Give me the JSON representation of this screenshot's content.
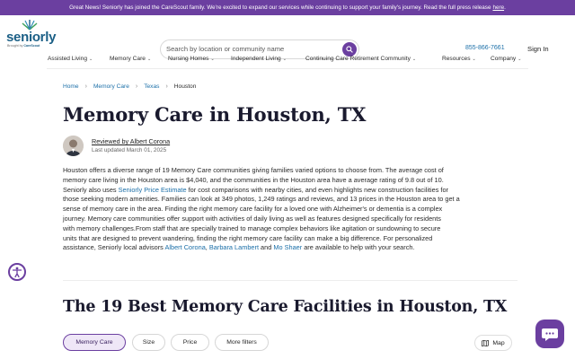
{
  "banner": {
    "text": "Great News! Seniorly has joined the CareScout family. We're excited to expand our services while continuing to support your family's journey. Read the full press release",
    "link": "here",
    "end": "."
  },
  "brand": {
    "name": "seniorly",
    "sub_prefix": "Brought by",
    "sub_brand": "CareScout",
    "color": "#1b5f86",
    "accent": "#6b3fa0"
  },
  "search": {
    "placeholder": "Search by location or community name",
    "icon": "search-icon"
  },
  "header": {
    "phone": "855-866-7661",
    "signin": "Sign In"
  },
  "nav": {
    "items": [
      "Assisted Living",
      "Memory Care",
      "Nursing Homes",
      "Independent Living",
      "Continuing Care Retirement Community",
      "Resources",
      "Company"
    ]
  },
  "breadcrumb": {
    "items": [
      "Home",
      "Memory Care",
      "Texas"
    ],
    "current": "Houston"
  },
  "page": {
    "title": "Memory Care in Houston, TX",
    "reviewed_by": "Reviewed by Albert Corona",
    "updated": "Last updated March 01, 2025"
  },
  "intro": {
    "lines": [
      [
        "Houston offers a diverse range of 19 Memory Care communities giving families varied options to choose from. The average cost of"
      ],
      [
        "memory care living in the Houston area is $4,040, and the communities in the Houston area have a average rating of 9.8 out of 10."
      ],
      [
        "Seniorly also uses ",
        {
          "link": "Seniorly Price Estimate"
        },
        " for cost comparisons with nearby cities, and even highlights new construction facilities for"
      ],
      [
        "those seeking modern amenities. Families can look at 349 photos, 1,249 ratings and reviews, and 13 prices in the Houston area to get a"
      ],
      [
        "sense of memory care in the area. Finding the right memory care facility for a loved one with Alzheimer's or dementia is a complex"
      ],
      [
        "journey. Memory care communities offer support with activities of daily living as well as features designed specifically for residents"
      ],
      [
        "with memory challenges.From staff that are specially trained to manage complex behaviors like agitation or sundowning to secure"
      ],
      [
        "units that are designed to prevent wandering, finding the right memory care facility can make a big difference. For personalized"
      ],
      [
        "assistance, Seniorly local advisors ",
        {
          "link": "Albert Corona"
        },
        ", ",
        {
          "link": "Barbara Lambert"
        },
        " and ",
        {
          "link": "Mo Shaer"
        },
        " are available to help with your search."
      ]
    ]
  },
  "section": {
    "title": "The 19 Best Memory Care Facilities in Houston, TX"
  },
  "filters": {
    "items": [
      "Memory Care",
      "Size",
      "Price",
      "More filters"
    ],
    "active": "Memory Care"
  },
  "map_button": {
    "label": "Map",
    "icon": "map-icon"
  },
  "widgets": {
    "accessibility_icon": "accessibility-icon",
    "chat_icon": "chat-icon"
  }
}
